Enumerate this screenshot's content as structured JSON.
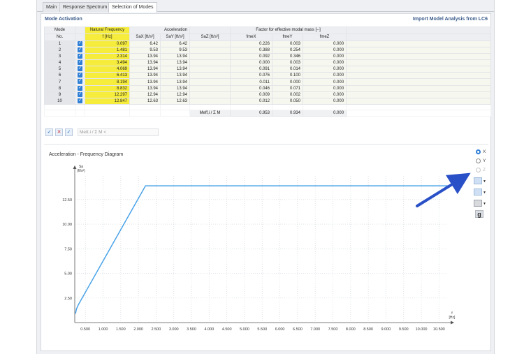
{
  "tabs": [
    "Main",
    "Response Spectrum",
    "Selection of Modes"
  ],
  "section_title": "Mode Activation",
  "import_link": "Import Model Analysis from LC6",
  "table": {
    "headers_top": {
      "mode": "Mode",
      "freq": "Natural Frequency",
      "accel": "Acceleration",
      "factor": "Factor for effective modal mass [--]"
    },
    "headers_sub": {
      "mode": "No.",
      "freq": "f [Hz]",
      "sax": "SaX [ft/s²]",
      "say": "SaY [ft/s²]",
      "saz": "SaZ [ft/s²]",
      "fx": "fmeX",
      "fy": "fmeY",
      "fz": "fmeZ"
    },
    "rows": [
      {
        "no": "1",
        "f": "0.097",
        "sax": "6.42",
        "say": "6.42",
        "fx": "0.226",
        "fy": "0.003",
        "fz": "0.000"
      },
      {
        "no": "2",
        "f": "1.481",
        "sax": "9.53",
        "say": "9.53",
        "fx": "0.388",
        "fy": "0.254",
        "fz": "0.000"
      },
      {
        "no": "3",
        "f": "2.314",
        "sax": "13.94",
        "say": "13.94",
        "fx": "0.092",
        "fy": "0.346",
        "fz": "0.000"
      },
      {
        "no": "4",
        "f": "3.494",
        "sax": "13.94",
        "say": "13.94",
        "fx": "0.000",
        "fy": "0.003",
        "fz": "0.000"
      },
      {
        "no": "5",
        "f": "4.069",
        "sax": "13.94",
        "say": "13.94",
        "fx": "0.091",
        "fy": "0.014",
        "fz": "0.000"
      },
      {
        "no": "6",
        "f": "6.413",
        "sax": "13.94",
        "say": "13.94",
        "fx": "0.076",
        "fy": "0.100",
        "fz": "0.000"
      },
      {
        "no": "7",
        "f": "8.194",
        "sax": "13.94",
        "say": "13.94",
        "fx": "0.011",
        "fy": "0.000",
        "fz": "0.000"
      },
      {
        "no": "8",
        "f": "8.832",
        "sax": "13.94",
        "say": "13.94",
        "fx": "0.046",
        "fy": "0.071",
        "fz": "0.000"
      },
      {
        "no": "9",
        "f": "12.297",
        "sax": "12.94",
        "say": "12.94",
        "fx": "0.009",
        "fy": "0.002",
        "fz": "0.000"
      },
      {
        "no": "10",
        "f": "12.847",
        "sax": "12.63",
        "say": "12.63",
        "fx": "0.012",
        "fy": "0.050",
        "fz": "0.000"
      }
    ],
    "sum_label": "Meff,i / Σ M",
    "sum": {
      "fx": "0.953",
      "fy": "0.934",
      "fz": "0.000"
    }
  },
  "toolbar": {
    "select_all": "✓",
    "deselect": "✕",
    "invert": "✓",
    "mett_label": "Mett.i / Σ M <"
  },
  "diagram": {
    "radios": [
      {
        "label": "X",
        "state": "on"
      },
      {
        "label": "Y",
        "state": "normal"
      },
      {
        "label": "Z",
        "state": "off"
      }
    ],
    "g_label": "g"
  },
  "chart_data": {
    "type": "line",
    "title": "Acceleration - Frequency Diagram",
    "ylabel": "Sa\n(ft/s²)",
    "xlabel": "f\n[Hz]",
    "ylim": [
      0,
      14.9
    ],
    "xlim": [
      0.2,
      10.75
    ],
    "yticks": [
      "2.50",
      "5.00",
      "7.50",
      "10.00",
      "12.50"
    ],
    "ytick_values": [
      2.5,
      5.0,
      7.5,
      10.0,
      12.5
    ],
    "xticks": [
      "0.500",
      "1.000",
      "1.500",
      "2.000",
      "2.500",
      "3.000",
      "3.500",
      "4.000",
      "4.500",
      "5.000",
      "5.500",
      "6.000",
      "6.500",
      "7.000",
      "7.500",
      "8.000",
      "8.500",
      "9.000",
      "9.500",
      "10.000",
      "10.500"
    ],
    "xtick_values": [
      0.5,
      1.0,
      1.5,
      2.0,
      2.5,
      3.0,
      3.5,
      4.0,
      4.5,
      5.0,
      5.5,
      6.0,
      6.5,
      7.0,
      7.5,
      8.0,
      8.5,
      9.0,
      9.5,
      10.0,
      10.5
    ],
    "grid": true,
    "series": [
      {
        "color": "#4aa3e8",
        "x": [
          0.22,
          0.25,
          0.3,
          2.2,
          10.75
        ],
        "y": [
          0.9,
          1.4,
          1.8,
          13.9,
          13.9
        ]
      }
    ]
  }
}
